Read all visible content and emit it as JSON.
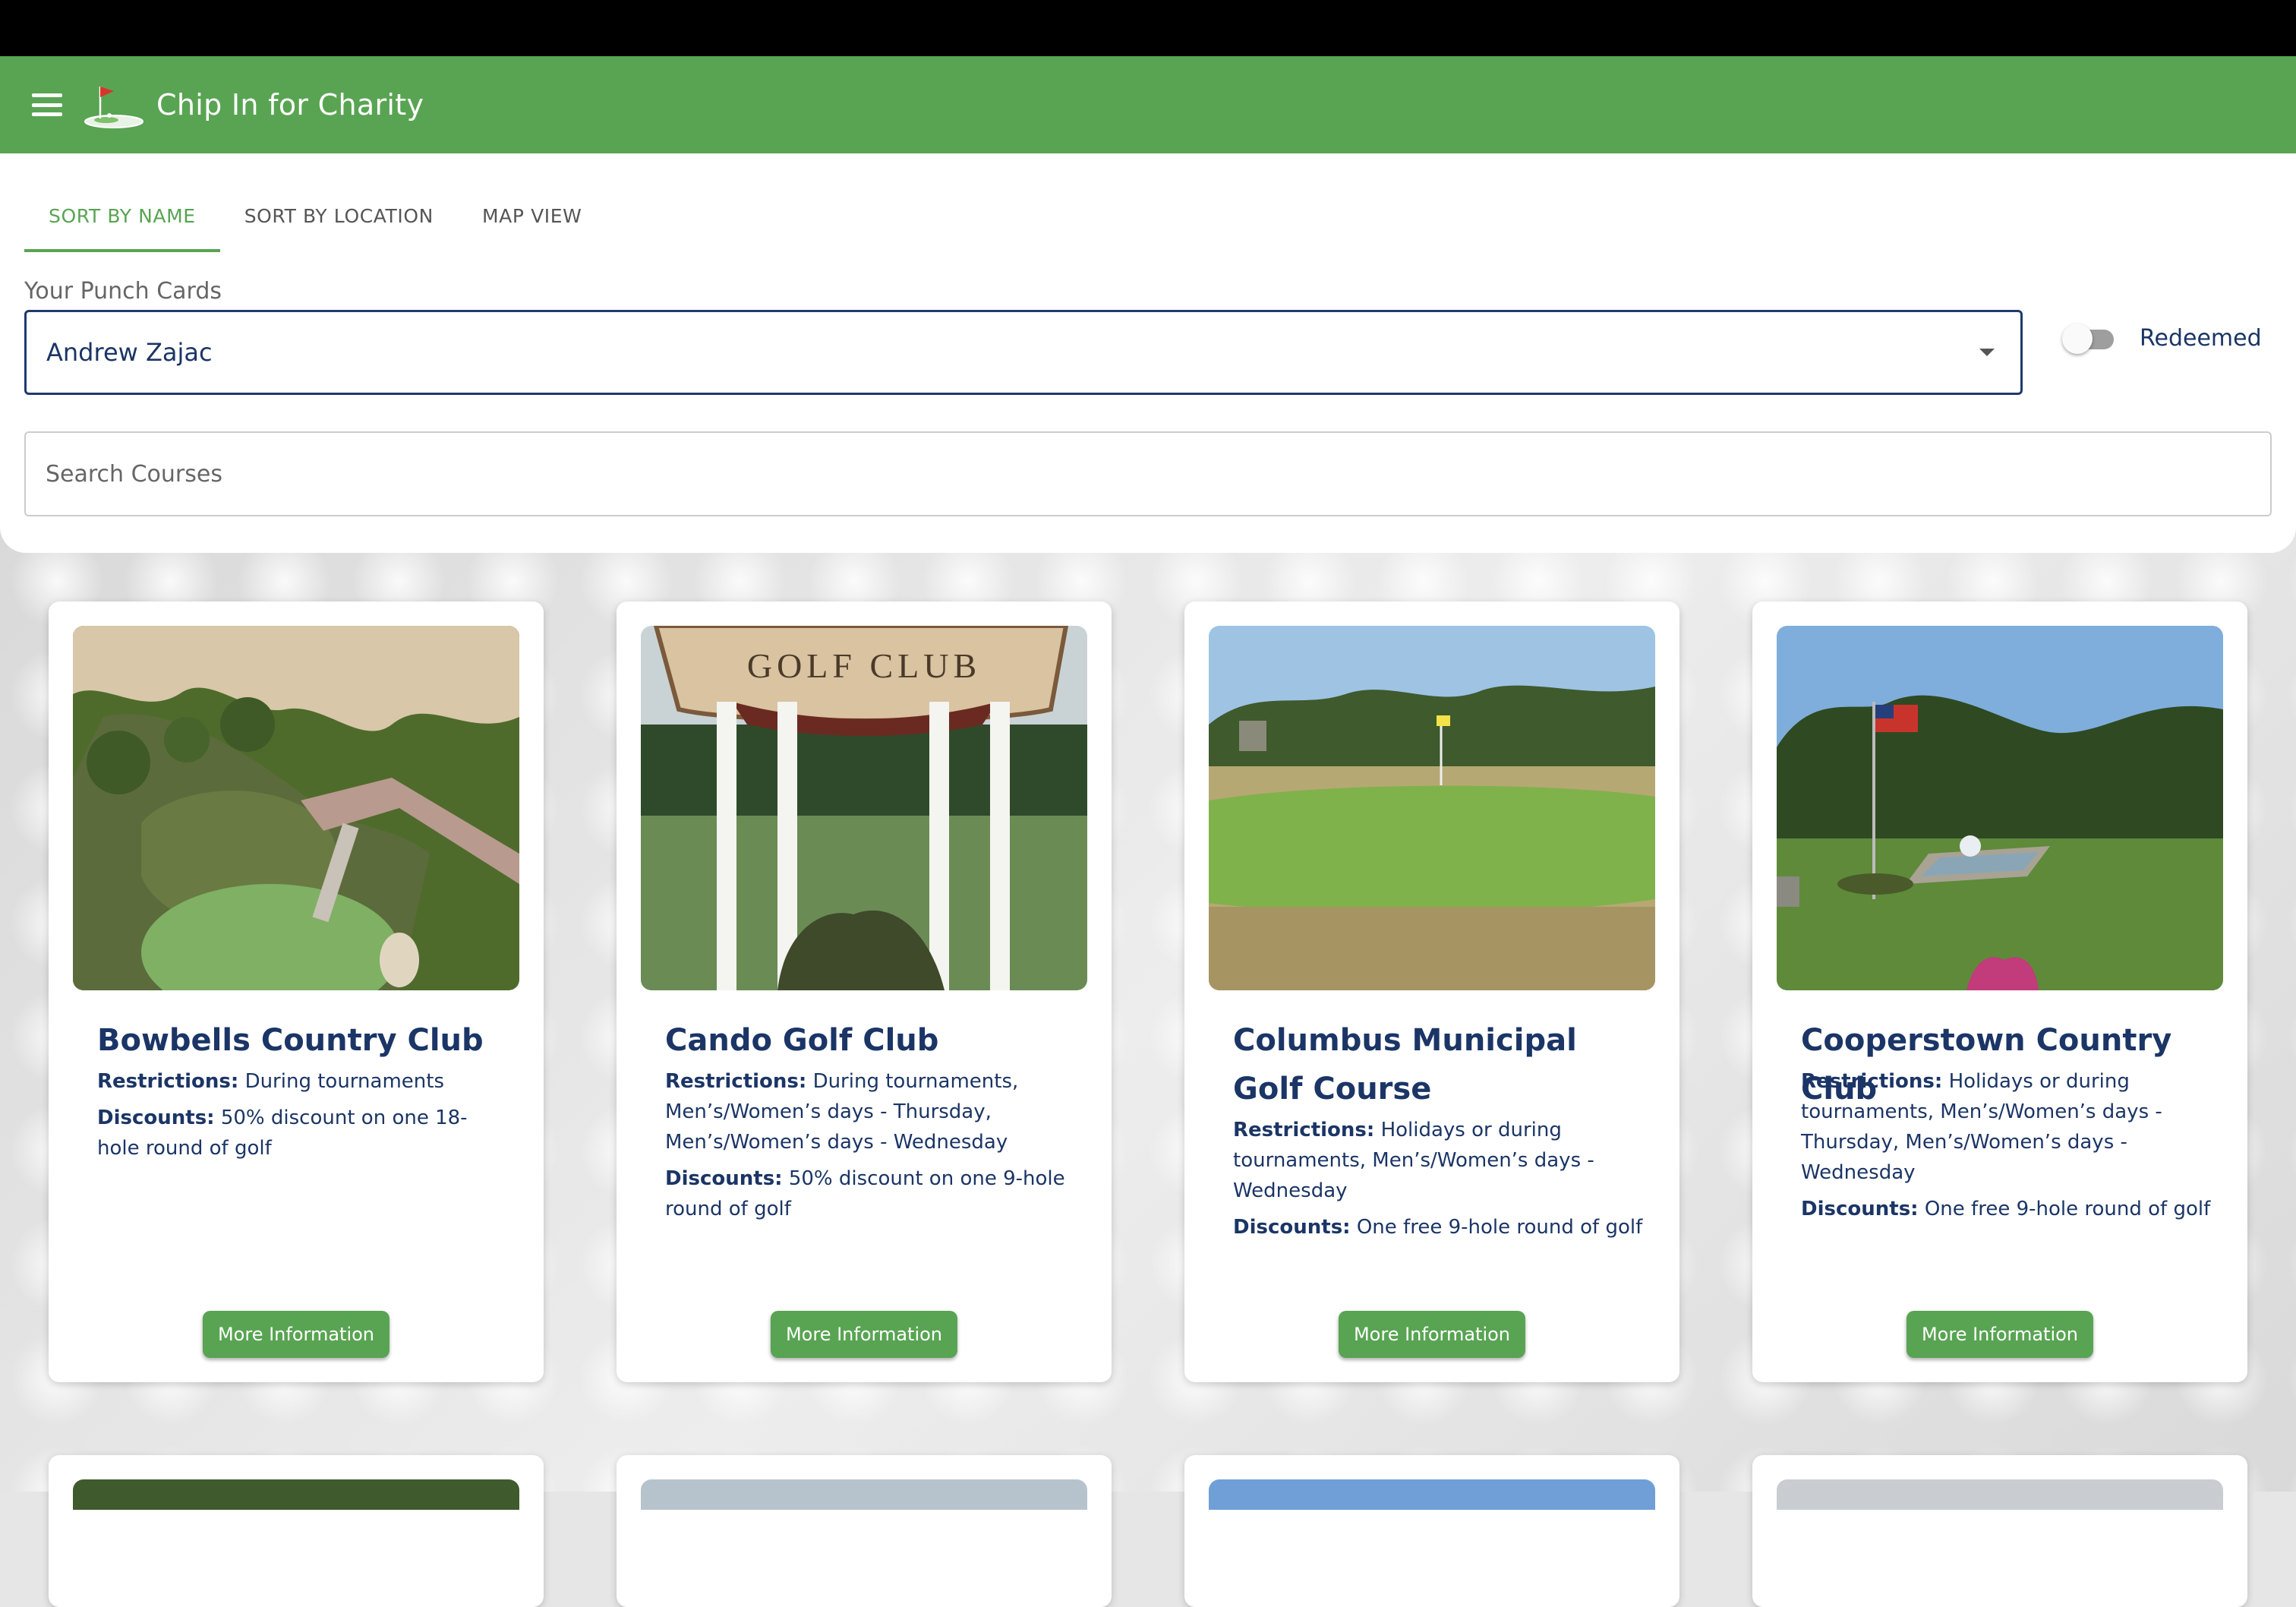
{
  "appbar": {
    "title": "Chip In for Charity",
    "menu_icon": "menu-icon",
    "logo": "golf-flag-logo"
  },
  "tabs": [
    {
      "label": "SORT BY NAME",
      "active": true
    },
    {
      "label": "SORT BY LOCATION",
      "active": false
    },
    {
      "label": "MAP VIEW",
      "active": false
    }
  ],
  "punch_cards": {
    "label": "Your Punch Cards",
    "selected": "Andrew Zajac"
  },
  "redeemed_toggle": {
    "label": "Redeemed",
    "checked": false
  },
  "search": {
    "placeholder": "Search Courses",
    "value": ""
  },
  "courses": [
    {
      "name": "Bowbells Country Club",
      "restrictions_label": "Restrictions:",
      "restrictions": "During tournaments",
      "discounts_label": "Discounts:",
      "discounts": "50% discount on one 18-hole round of golf",
      "button": "More Information"
    },
    {
      "name": "Cando Golf Club",
      "restrictions_label": "Restrictions:",
      "restrictions": "During tournaments, Men’s/Women’s days - Thursday, Men’s/Women’s days - Wednesday",
      "discounts_label": "Discounts:",
      "discounts": "50% discount on one 9-hole round of golf",
      "button": "More Information",
      "sign_text": "GOLF CLUB"
    },
    {
      "name": "Columbus Municipal Golf Course",
      "restrictions_label": "Restrictions:",
      "restrictions": "Holidays or during tournaments, Men’s/Women’s days - Wednesday",
      "discounts_label": "Discounts:",
      "discounts": "One free 9-hole round of golf",
      "button": "More Information"
    },
    {
      "name": "Cooperstown Country Club",
      "restrictions_label": "Restrictions:",
      "restrictions": "Holidays or during tournaments, Men’s/Women’s days - Thursday, Men’s/Women’s days - Wednesday",
      "discounts_label": "Discounts:",
      "discounts": "One free 9-hole round of golf",
      "button": "More Information"
    }
  ],
  "colors": {
    "brand_green": "#58a452",
    "text_navy": "#1b3566",
    "select_border": "#1f3a6d"
  }
}
